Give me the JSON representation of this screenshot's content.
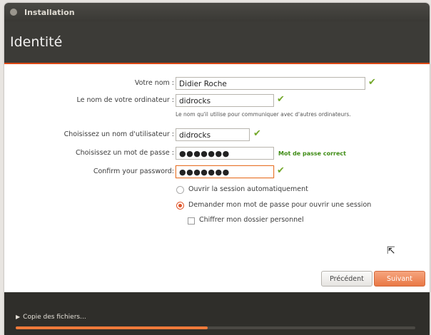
{
  "window": {
    "title": "Installation"
  },
  "page": {
    "heading": "Identité"
  },
  "form": {
    "name_label": "Votre nom :",
    "name_value": "Didier Roche",
    "computer_label": "Le nom de votre ordinateur :",
    "computer_value": "didrocks",
    "computer_hint": "Le nom qu'il utilise pour communiquer avec d'autres ordinateurs.",
    "username_label": "Choisissez un nom d'utilisateur :",
    "username_value": "didrocks",
    "password_label": "Choisissez un mot de passe :",
    "password_value": "●●●●●●●",
    "password_status": "Mot de passe correct",
    "confirm_label": "Confirm your password:",
    "confirm_value": "●●●●●●●",
    "check_icon": "✔"
  },
  "options": {
    "auto_login": "Ouvrir la session automatiquement",
    "ask_password": "Demander mon mot de passe pour ouvrir une session",
    "encrypt_home": "Chiffrer mon dossier personnel",
    "selected": "ask_password"
  },
  "buttons": {
    "previous": "Précédent",
    "next": "Suivant"
  },
  "footer": {
    "progress_label": "Copie des fichiers...",
    "progress": 0.48,
    "triangle": "▶"
  },
  "colors": {
    "accent": "#e97845",
    "check": "#73a82a",
    "header_bg": "#3c3b37"
  }
}
